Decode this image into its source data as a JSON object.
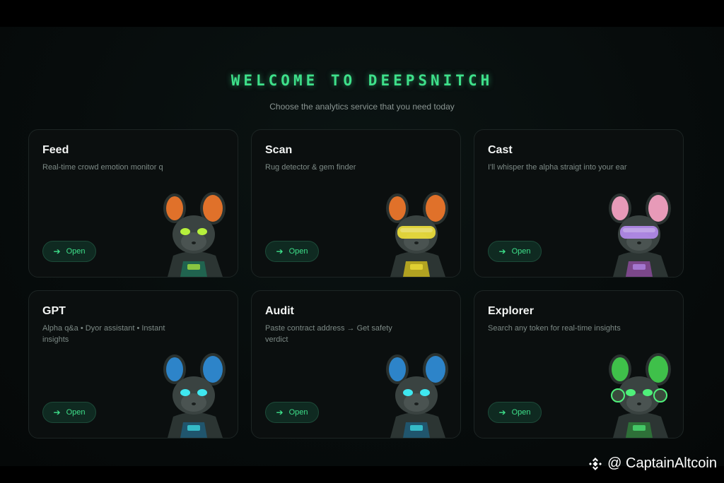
{
  "page": {
    "title": "WELCOME TO DEEPSNITCH",
    "subtitle": "Choose the analytics service that you need today"
  },
  "cards": [
    {
      "title": "Feed",
      "description": "Real-time crowd emotion monitor q",
      "button": "Open",
      "mascot": "mouse-hood-orange-ears",
      "accent": "#e0712a",
      "eyes": "#b6f03c",
      "suit": "#1f6b55"
    },
    {
      "title": "Scan",
      "description": "Rug detector & gem finder",
      "button": "Open",
      "mascot": "mouse-yellow-goggles",
      "accent": "#e0712a",
      "eyes": "#f2e23a",
      "suit": "#c9b51f"
    },
    {
      "title": "Cast",
      "description": "I'll whisper the alpha straigt into your ear",
      "button": "Open",
      "mascot": "mouse-vr-headset-pink",
      "accent": "#e79ab8",
      "eyes": "#b78cf0",
      "suit": "#8a4a9a"
    },
    {
      "title": "GPT",
      "description": "Alpha q&a • Dyor assistant • Instant insights",
      "button": "Open",
      "mascot": "mouse-blue-ears",
      "accent": "#2d84c9",
      "eyes": "#3fe7f0",
      "suit": "#1e5a78"
    },
    {
      "title": "Audit",
      "description": "Paste contract address → Get safety verdict",
      "button": "Open",
      "mascot": "mouse-blue-hood",
      "accent": "#2d84c9",
      "eyes": "#3fe7f0",
      "suit": "#1e5a78"
    },
    {
      "title": "Explorer",
      "description": "Search any token for real-time insights",
      "button": "Open",
      "mascot": "mouse-green-headphones",
      "accent": "#3fc04a",
      "eyes": "#4ff07a",
      "suit": "#2f7a3a"
    }
  ],
  "watermark": {
    "text": "@ CaptainAltcoin",
    "icon": "binance-logo-icon"
  },
  "colors": {
    "accent_green": "#3ee08a",
    "card_bg": "#0b0f0f",
    "page_bg": "#070c0c"
  }
}
